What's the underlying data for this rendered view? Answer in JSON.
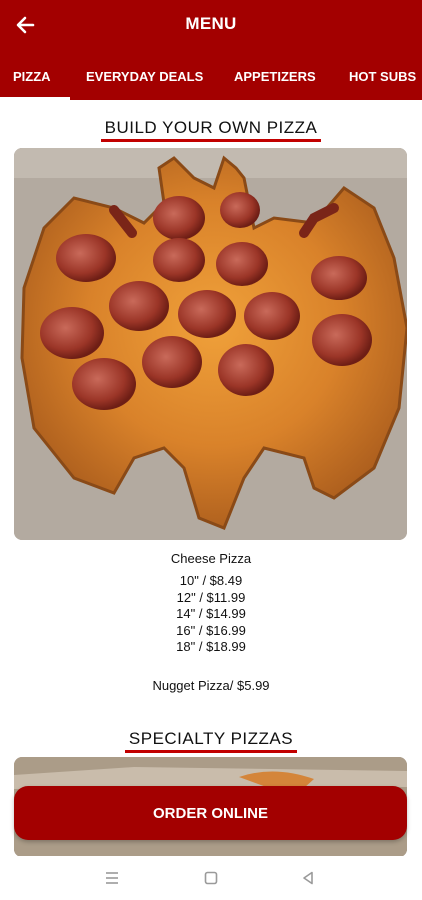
{
  "header": {
    "title": "MENU",
    "tabs": [
      {
        "label": "PIZZA",
        "selected": true
      },
      {
        "label": "EVERYDAY DEALS",
        "selected": false
      },
      {
        "label": "APPETIZERS",
        "selected": false
      },
      {
        "label": "HOT SUBS",
        "selected": false
      }
    ]
  },
  "sections": {
    "build": {
      "heading": "BUILD YOUR OWN PIZZA",
      "item_title": "Cheese Pizza",
      "prices": [
        "10\" / $8.49",
        "12\" / $11.99",
        "14\" / $14.99",
        "16\" / $16.99",
        "18\" / $18.99"
      ],
      "extra": "Nugget Pizza/ $5.99"
    },
    "specialty": {
      "heading": "SPECIALTY PIZZAS"
    }
  },
  "order_button": {
    "label": "ORDER ONLINE"
  },
  "colors": {
    "brand": "#a30000",
    "underline": "#c20000",
    "background": "#ffffff"
  },
  "icons": [
    "back-arrow-icon",
    "recents-icon",
    "home-icon",
    "back-triangle-icon"
  ]
}
